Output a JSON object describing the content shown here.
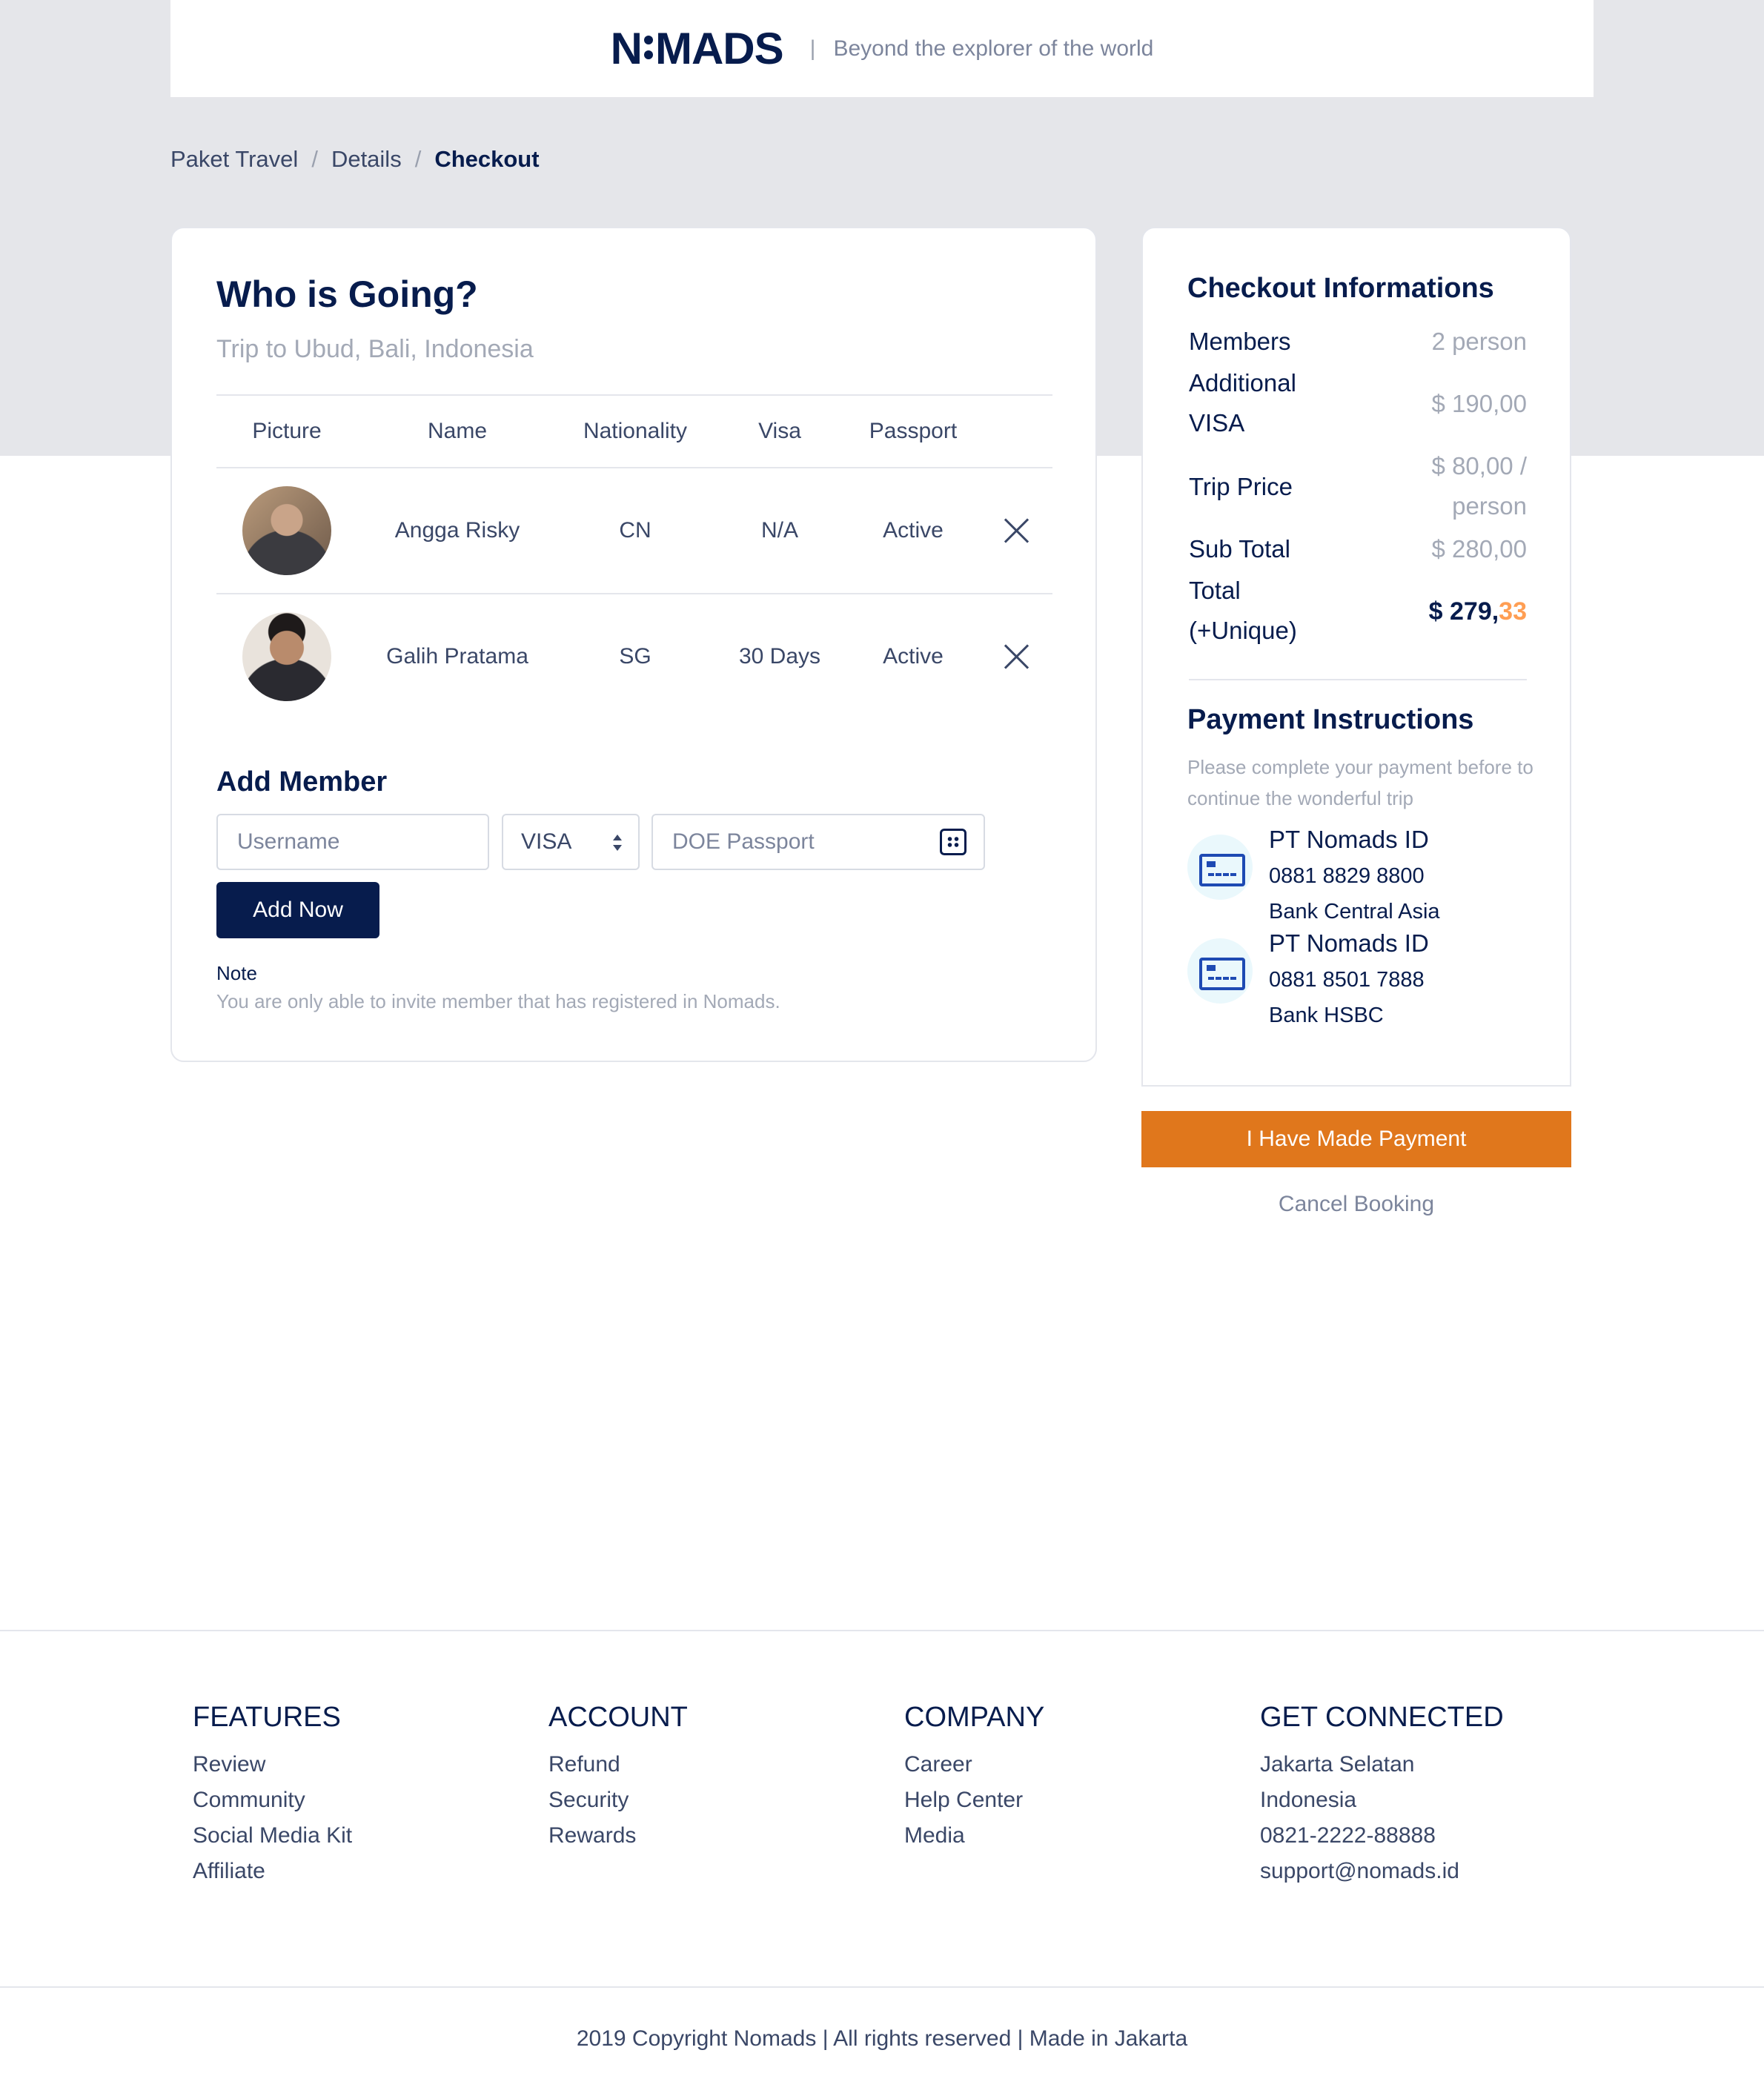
{
  "header": {
    "logo_left": "N",
    "logo_right": "MADS",
    "separator": "|",
    "tagline": "Beyond the explorer of the world"
  },
  "breadcrumb": [
    {
      "label": "Paket Travel"
    },
    {
      "label": "Details"
    },
    {
      "label": "Checkout"
    }
  ],
  "breadcrumb_sep": "/",
  "members_card": {
    "title": "Who is Going?",
    "subtitle": "Trip to Ubud, Bali, Indonesia",
    "columns": [
      "Picture",
      "Name",
      "Nationality",
      "Visa",
      "Passport"
    ],
    "rows": [
      {
        "name": "Angga Risky",
        "nationality": "CN",
        "visa": "N/A",
        "passport": "Active"
      },
      {
        "name": "Galih Pratama",
        "nationality": "SG",
        "visa": "30 Days",
        "passport": "Active"
      }
    ],
    "add_title": "Add Member",
    "username_placeholder": "Username",
    "visa_select": "VISA",
    "doe_placeholder": "DOE Passport",
    "add_button": "Add Now",
    "note_label": "Note",
    "note_text": "You are only able to invite member that has registered in Nomads."
  },
  "checkout": {
    "title": "Checkout Informations",
    "members_label": "Members",
    "members_value": "2 person",
    "visa_label_1": "Additional",
    "visa_label_2": "VISA",
    "visa_value": "$ 190,00",
    "trip_label": "Trip Price",
    "trip_value_1": "$ 80,00 /",
    "trip_value_2": "person",
    "subtotal_label": "Sub Total",
    "subtotal_value": "$ 280,00",
    "total_label_1": "Total",
    "total_label_2": "(+Unique)",
    "total_value_main": "$ 279,",
    "total_value_cents": "33"
  },
  "payment": {
    "title": "Payment Instructions",
    "desc": "Please complete your payment before to continue the wonderful trip",
    "banks": [
      {
        "name": "PT Nomads ID",
        "number": "0881 8829 8800",
        "bank": "Bank Central Asia"
      },
      {
        "name": "PT Nomads ID",
        "number": "0881 8501 7888",
        "bank": "Bank HSBC"
      }
    ],
    "paid_button": "I Have Made Payment",
    "cancel_link": "Cancel Booking"
  },
  "footer": {
    "columns": [
      {
        "heading": "FEATURES",
        "items": [
          "Review",
          "Community",
          "Social Media Kit",
          "Affiliate"
        ]
      },
      {
        "heading": "ACCOUNT",
        "items": [
          "Refund",
          "Security",
          "Rewards"
        ]
      },
      {
        "heading": "COMPANY",
        "items": [
          "Career",
          "Help Center",
          "Media"
        ]
      },
      {
        "heading": "GET CONNECTED",
        "items": [
          "Jakarta Selatan",
          "Indonesia",
          "0821-2222-88888",
          "support@nomads.id"
        ]
      }
    ],
    "copyright": "2019 Copyright Nomads | All rights reserved | Made in Jakarta"
  },
  "colors": {
    "navy": "#071C4D",
    "orange_button": "#E0771C",
    "orange_cents": "#FF9E53",
    "gray_band": "#E5E6EA"
  },
  "icons": [
    "calendar-icon",
    "close-icon",
    "credit-card-icon",
    "select-arrows-icon"
  ]
}
